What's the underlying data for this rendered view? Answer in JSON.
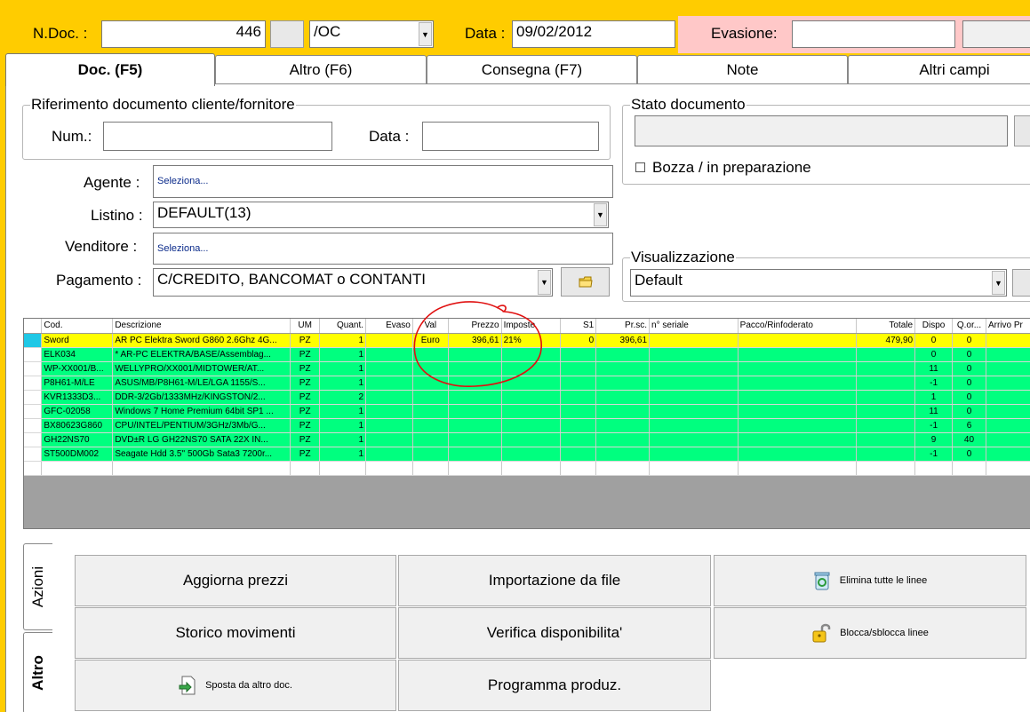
{
  "header": {
    "ndoc_label": "N.Doc. :",
    "ndoc_value": "446",
    "series_value": "/OC",
    "date_label": "Data :",
    "date_value": "09/02/2012",
    "evasione_label": "Evasione:",
    "evasione_value": ""
  },
  "tabs": [
    {
      "label": "Doc. (F5)",
      "active": true
    },
    {
      "label": "Altro (F6)"
    },
    {
      "label": "Consegna (F7)"
    },
    {
      "label": "Note"
    },
    {
      "label": "Altri campi"
    }
  ],
  "riferimento": {
    "title": "Riferimento documento cliente/fornitore",
    "num_label": "Num.:",
    "num_value": "",
    "data_label": "Data :",
    "data_value": ""
  },
  "stato": {
    "title": "Stato documento",
    "value": "",
    "bozza_label": "Bozza / in preparazione"
  },
  "form": {
    "agente_label": "Agente :",
    "agente_value": "Seleziona...",
    "listino_label": "Listino :",
    "listino_value": "DEFAULT(13)",
    "venditore_label": "Venditore :",
    "venditore_value": "Seleziona...",
    "pagamento_label": "Pagamento :",
    "pagamento_value": "C/CREDITO, BANCOMAT o CONTANTI"
  },
  "visualizzazione": {
    "title": "Visualizzazione",
    "value": "Default"
  },
  "grid": {
    "columns": [
      "Cod.",
      "Descrizione",
      "UM",
      "Quant.",
      "Evaso",
      "Val",
      "Prezzo",
      "Imposte",
      "S1",
      "Pr.sc.",
      "n° seriale",
      "Pacco/Rinfoderato",
      "Totale",
      "Dispo",
      "Q.or...",
      "Arrivo Pr"
    ],
    "rows": [
      {
        "cod": "Sword",
        "desc": "AR PC Elektra Sword G860 2.6Ghz 4G...",
        "um": "PZ",
        "quant": "1",
        "evaso": "",
        "val": "Euro",
        "prezzo": "396,61",
        "imposte": "21%",
        "s1": "0",
        "prsc": "396,61",
        "seriale": "",
        "pacco": "",
        "totale": "479,90",
        "dispo": "0",
        "qor": "0",
        "arrivo": "",
        "style": "yellow"
      },
      {
        "cod": "ELK034",
        "desc": "* AR-PC ELEKTRA/BASE/Assemblag...",
        "um": "PZ",
        "quant": "1",
        "evaso": "",
        "val": "",
        "prezzo": "",
        "imposte": "",
        "s1": "",
        "prsc": "",
        "seriale": "",
        "pacco": "",
        "totale": "",
        "dispo": "0",
        "qor": "0",
        "arrivo": "",
        "style": "green"
      },
      {
        "cod": "WP-XX001/B...",
        "desc": "WELLYPRO/XX001/MIDTOWER/AT...",
        "um": "PZ",
        "quant": "1",
        "evaso": "",
        "val": "",
        "prezzo": "",
        "imposte": "",
        "s1": "",
        "prsc": "",
        "seriale": "",
        "pacco": "",
        "totale": "",
        "dispo": "11",
        "qor": "0",
        "arrivo": "",
        "style": "green"
      },
      {
        "cod": "P8H61-M/LE",
        "desc": "ASUS/MB/P8H61-M/LE/LGA 1155/S...",
        "um": "PZ",
        "quant": "1",
        "evaso": "",
        "val": "",
        "prezzo": "",
        "imposte": "",
        "s1": "",
        "prsc": "",
        "seriale": "",
        "pacco": "",
        "totale": "",
        "dispo": "-1",
        "qor": "0",
        "arrivo": "",
        "style": "green"
      },
      {
        "cod": "KVR1333D3...",
        "desc": "DDR-3/2Gb/1333MHz/KINGSTON/2...",
        "um": "PZ",
        "quant": "2",
        "evaso": "",
        "val": "",
        "prezzo": "",
        "imposte": "",
        "s1": "",
        "prsc": "",
        "seriale": "",
        "pacco": "",
        "totale": "",
        "dispo": "1",
        "qor": "0",
        "arrivo": "",
        "style": "green"
      },
      {
        "cod": "GFC-02058",
        "desc": "Windows 7 Home Premium 64bit SP1 ...",
        "um": "PZ",
        "quant": "1",
        "evaso": "",
        "val": "",
        "prezzo": "",
        "imposte": "",
        "s1": "",
        "prsc": "",
        "seriale": "",
        "pacco": "",
        "totale": "",
        "dispo": "11",
        "qor": "0",
        "arrivo": "",
        "style": "green"
      },
      {
        "cod": "BX80623G860",
        "desc": "CPU/INTEL/PENTIUM/3GHz/3Mb/G...",
        "um": "PZ",
        "quant": "1",
        "evaso": "",
        "val": "",
        "prezzo": "",
        "imposte": "",
        "s1": "",
        "prsc": "",
        "seriale": "",
        "pacco": "",
        "totale": "",
        "dispo": "-1",
        "qor": "6",
        "arrivo": "",
        "style": "green"
      },
      {
        "cod": "GH22NS70",
        "desc": "DVD±R LG GH22NS70 SATA 22X IN...",
        "um": "PZ",
        "quant": "1",
        "evaso": "",
        "val": "",
        "prezzo": "",
        "imposte": "",
        "s1": "",
        "prsc": "",
        "seriale": "",
        "pacco": "",
        "totale": "",
        "dispo": "9",
        "qor": "40",
        "arrivo": "",
        "style": "green"
      },
      {
        "cod": "ST500DM002",
        "desc": "Seagate Hdd 3.5'' 500Gb Sata3 7200r...",
        "um": "PZ",
        "quant": "1",
        "evaso": "",
        "val": "",
        "prezzo": "",
        "imposte": "",
        "s1": "",
        "prsc": "",
        "seriale": "",
        "pacco": "",
        "totale": "",
        "dispo": "-1",
        "qor": "0",
        "arrivo": "",
        "style": "green"
      },
      {
        "cod": "",
        "desc": "",
        "um": "",
        "quant": "",
        "evaso": "",
        "val": "",
        "prezzo": "",
        "imposte": "",
        "s1": "",
        "prsc": "",
        "seriale": "",
        "pacco": "",
        "totale": "",
        "dispo": "",
        "qor": "",
        "arrivo": "",
        "style": "blank"
      }
    ]
  },
  "side_tabs": [
    {
      "label": "Azioni"
    },
    {
      "label": "Altro",
      "active": true
    }
  ],
  "actions": {
    "aggiorna_prezzi": "Aggiorna prezzi",
    "importazione": "Importazione da file",
    "elimina_linee": "Elimina tutte le linee",
    "storico": "Storico movimenti",
    "verifica": "Verifica disponibilita'",
    "blocca": "Blocca/sblocca linee",
    "sposta": "Sposta da altro doc.",
    "programma": "Programma produz."
  },
  "icons": {
    "trash": "recycle-bin-icon",
    "padlock": "padlock-icon",
    "import": "document-import-icon",
    "folder": "folder-icon"
  },
  "colors": {
    "background": "#ffcc00",
    "evasione_bg": "#ffc8c8",
    "row_selected": "#ffff00",
    "row_normal": "#00ff7f",
    "annotation": "#e01010"
  }
}
